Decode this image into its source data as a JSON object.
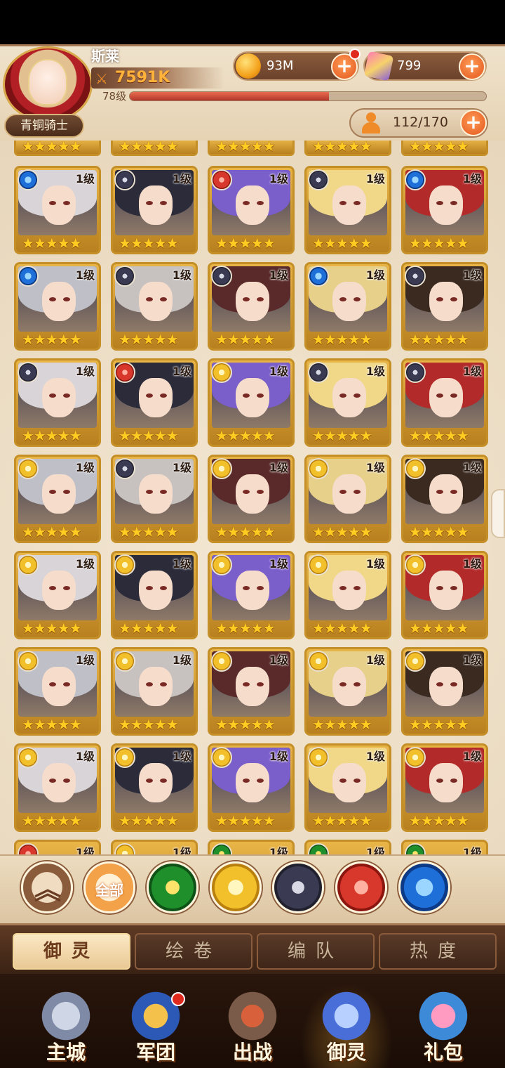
{
  "player": {
    "name": "斯莱",
    "power": "7591K",
    "level": "78级",
    "xp_fraction": 0.56,
    "rank": "青铜骑士"
  },
  "currency": {
    "gold": "93M",
    "gems": "799"
  },
  "capacity": "112/170",
  "colors": {
    "accent": "#e2561c",
    "card_gold": "#c58f27",
    "header_bg": "#efe2cb",
    "nav_bg": "#2a160c"
  },
  "elements": {
    "water": "water-swirl-icon",
    "dark": "dark-star-icon",
    "fire": "fire-phoenix-icon",
    "light": "light-rose-icon",
    "wind": "wind-dragon-icon"
  },
  "rows": [
    [
      "water",
      "dark",
      "fire",
      "dark",
      "water"
    ],
    [
      "water",
      "dark",
      "dark",
      "water",
      "dark"
    ],
    [
      "dark",
      "fire",
      "light",
      "dark",
      "dark"
    ],
    [
      "light",
      "dark",
      "light",
      "light",
      "light"
    ],
    [
      "light",
      "light",
      "light",
      "light",
      "light"
    ],
    [
      "light",
      "light",
      "light",
      "light",
      "light"
    ],
    [
      "light",
      "light",
      "light",
      "light",
      "light"
    ]
  ],
  "card_level": "1级",
  "card_stars": 5,
  "filters": {
    "all_label": "全部"
  },
  "tabs": [
    "御灵",
    "绘卷",
    "编队",
    "热度"
  ],
  "nav": [
    "主城",
    "军团",
    "出战",
    "御灵",
    "礼包"
  ]
}
